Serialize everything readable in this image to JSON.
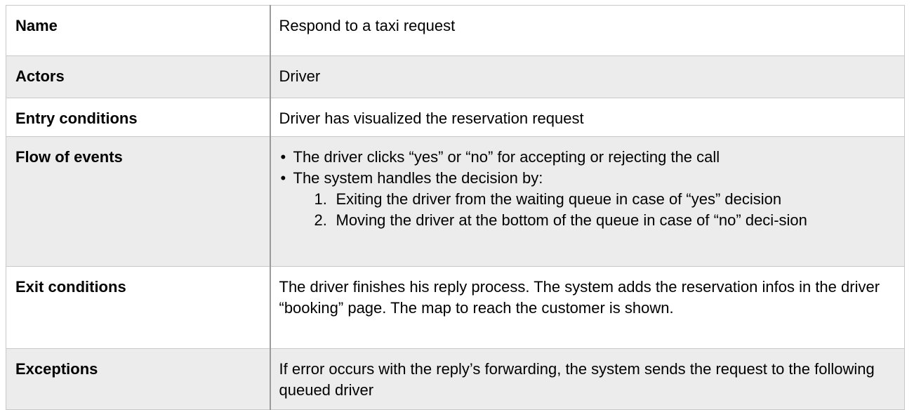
{
  "table": {
    "rows": {
      "name": {
        "label": "Name",
        "value": "Respond to a taxi request"
      },
      "actors": {
        "label": "Actors",
        "value": "Driver"
      },
      "entry": {
        "label": "Entry conditions",
        "value": "Driver has visualized the reservation request"
      },
      "flow": {
        "label": "Flow of events",
        "bullets": [
          "The driver clicks “yes” or “no” for accepting or rejecting the call",
          "The system handles the decision by:"
        ],
        "steps": [
          {
            "num": "1.",
            "text": "Exiting the driver from the waiting queue in case of “yes” decision"
          },
          {
            "num": "2.",
            "text": "Moving the driver at the bottom of the queue in case of “no” deci-sion"
          }
        ]
      },
      "exit": {
        "label": "Exit conditions",
        "value": "The driver finishes his reply process. The system adds the reservation infos in the driver “booking” page. The map to reach the customer is shown."
      },
      "exceptions": {
        "label": "Exceptions",
        "value": "If error occurs with the reply’s forwarding, the system sends the request to the following queued driver"
      }
    },
    "bullet_glyph": "•"
  },
  "colors": {
    "shade": "#ececec",
    "border": "#c8c8c8",
    "divider": "#9a9a9a"
  }
}
